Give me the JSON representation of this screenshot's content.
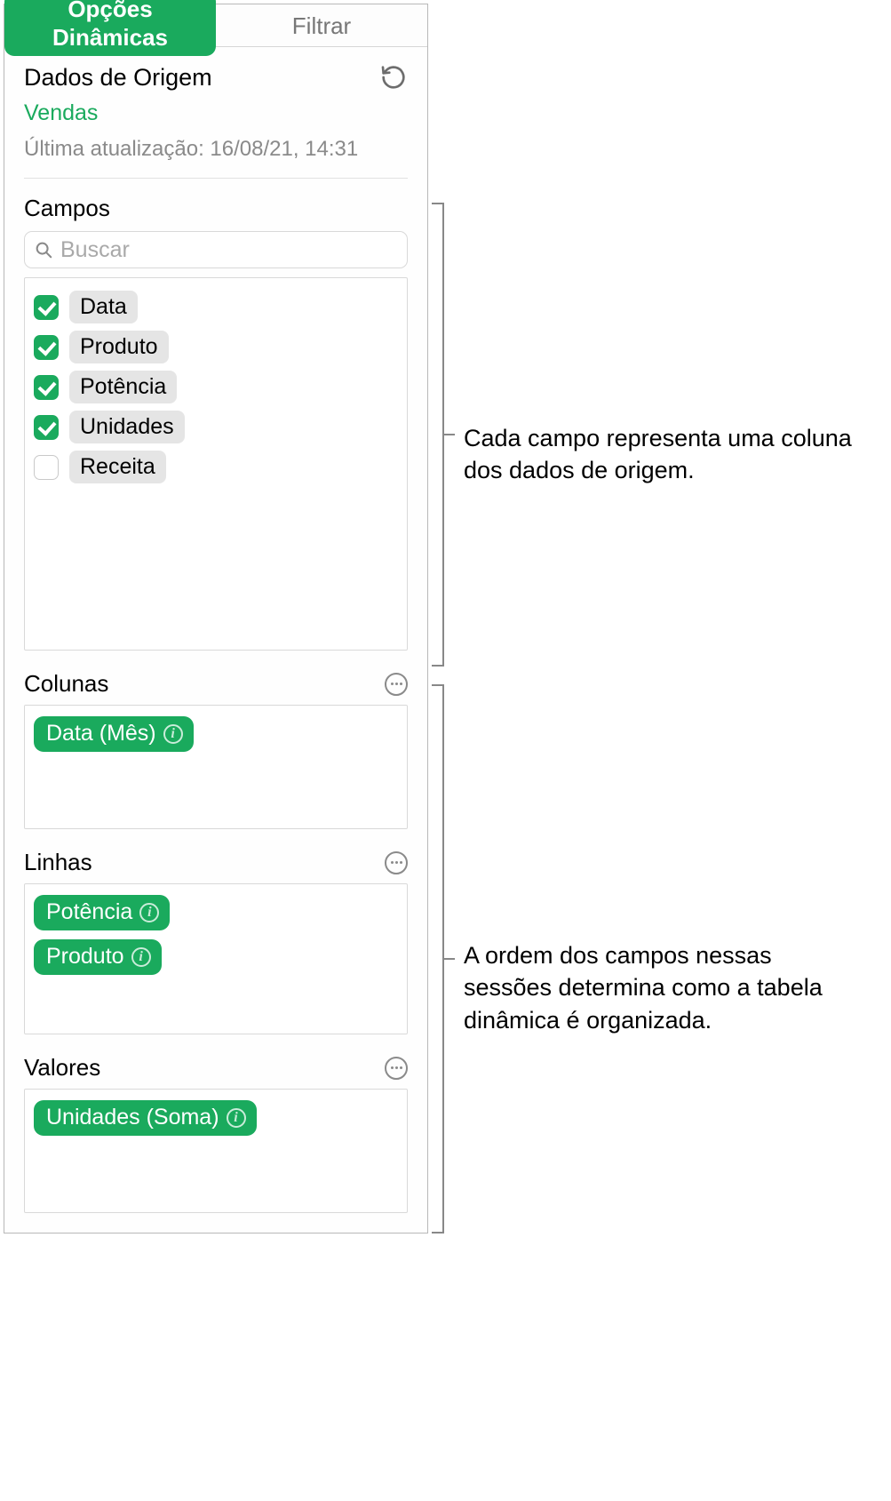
{
  "tabs": {
    "pivot": "Opções Dinâmicas",
    "filter": "Filtrar"
  },
  "source": {
    "title": "Dados de Origem",
    "name": "Vendas",
    "updated": "Última atualização: 16/08/21, 14:31"
  },
  "fields": {
    "section_title": "Campos",
    "search_placeholder": "Buscar",
    "items": [
      {
        "label": "Data",
        "checked": true
      },
      {
        "label": "Produto",
        "checked": true
      },
      {
        "label": "Potência",
        "checked": true
      },
      {
        "label": "Unidades",
        "checked": true
      },
      {
        "label": "Receita",
        "checked": false
      }
    ]
  },
  "columns": {
    "title": "Colunas",
    "items": [
      {
        "label": "Data (Mês)"
      }
    ]
  },
  "rows": {
    "title": "Linhas",
    "items": [
      {
        "label": "Potência"
      },
      {
        "label": "Produto"
      }
    ]
  },
  "values": {
    "title": "Valores",
    "items": [
      {
        "label": "Unidades (Soma)"
      }
    ]
  },
  "callouts": {
    "fields": "Cada campo representa uma coluna dos dados de origem.",
    "zones": "A ordem dos campos nessas sessões determina como a tabela dinâmica é organizada."
  },
  "colors": {
    "accent": "#1aaa5d"
  }
}
